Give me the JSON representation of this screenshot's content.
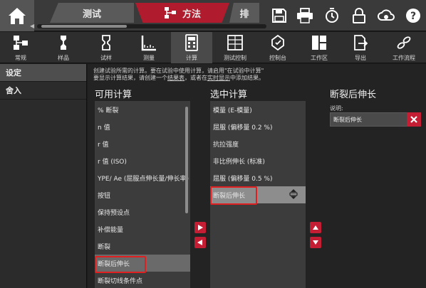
{
  "topbar": {
    "tabs": [
      {
        "label": "测试"
      },
      {
        "label": "方法"
      },
      {
        "label": "排"
      }
    ],
    "icons": [
      "home-icon",
      "save-icon",
      "print-icon",
      "reset-timer-icon",
      "lock-icon",
      "cloud-icon",
      "help-icon"
    ]
  },
  "toolbar": {
    "items": [
      {
        "label": "常规",
        "icon": "general-icon"
      },
      {
        "label": "样品",
        "icon": "specimen-icon"
      },
      {
        "label": "试样",
        "icon": "sample-icon"
      },
      {
        "label": "测量",
        "icon": "measure-icon"
      },
      {
        "label": "计算",
        "icon": "calculator-icon"
      },
      {
        "label": "测试控制",
        "icon": "test-control-icon"
      },
      {
        "label": "控制台",
        "icon": "console-icon"
      },
      {
        "label": "工作区",
        "icon": "workspace-icon"
      },
      {
        "label": "导出",
        "icon": "export-icon"
      },
      {
        "label": "工作流程",
        "icon": "workflow-icon"
      }
    ],
    "active": "计算"
  },
  "sidebar": {
    "items": [
      {
        "label": "设定"
      },
      {
        "label": "舍入"
      }
    ]
  },
  "main": {
    "description_line1": "创建试验所需的计算。要在试验中使用计算，请启用\"在试验中计算\"",
    "description_line2_pre": "要显示计算结果，请创建一个",
    "description_link1": "结果表",
    "description_line2_mid": "，或者在",
    "description_link2": "实时显示",
    "description_line2_post": "中添加结果。",
    "available_title": "可用计算",
    "selected_title": "选中计算",
    "detail_title": "断裂后伸长",
    "available": [
      "% 断裂",
      "n 值",
      "r 值",
      "r 值 (ISO)",
      "YPE/ Ae (屈服点伸长量/伸长率)",
      "按钮",
      "保持预设点",
      "补偿能量",
      "断裂",
      "断裂后伸长",
      "断裂切线条件点"
    ],
    "selected": [
      "模量 (E-模量)",
      "屈服 (偏移量 0.2 %)",
      "抗拉强度",
      "非比例伸长 (标准)",
      "屈服 (偏移量 0.5 %)",
      "断裂后伸长"
    ],
    "description_label": "说明:",
    "description_value": "断裂后伸长"
  },
  "colors": {
    "accent": "#c41e34",
    "background": "#232323",
    "panel": "#3c3c3c"
  }
}
